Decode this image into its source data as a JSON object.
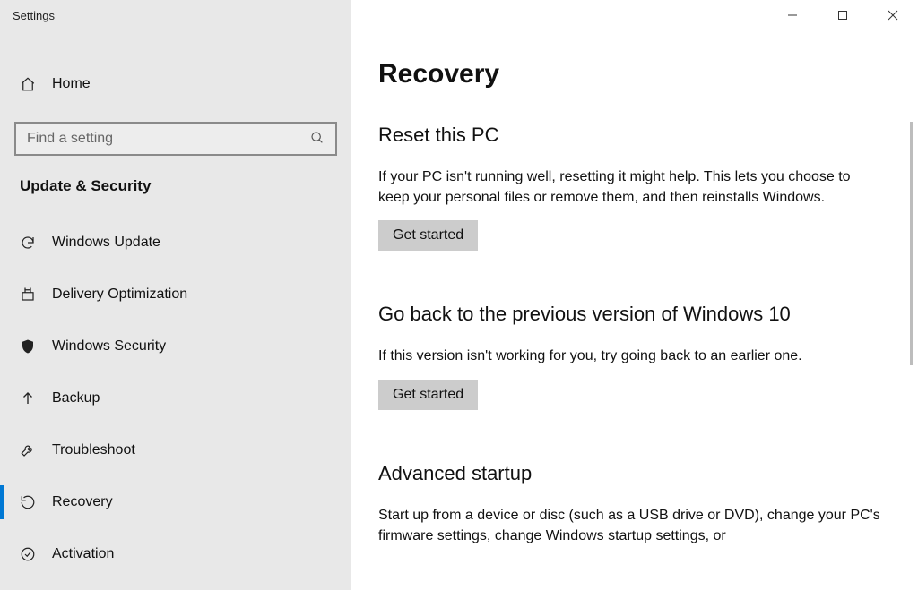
{
  "window": {
    "title": "Settings"
  },
  "sidebar": {
    "home_label": "Home",
    "search_placeholder": "Find a setting",
    "category": "Update & Security",
    "items": [
      {
        "label": "Windows Update"
      },
      {
        "label": "Delivery Optimization"
      },
      {
        "label": "Windows Security"
      },
      {
        "label": "Backup"
      },
      {
        "label": "Troubleshoot"
      },
      {
        "label": "Recovery"
      },
      {
        "label": "Activation"
      }
    ]
  },
  "page": {
    "title": "Recovery",
    "sections": [
      {
        "title": "Reset this PC",
        "desc": "If your PC isn't running well, resetting it might help. This lets you choose to keep your personal files or remove them, and then reinstalls Windows.",
        "button": "Get started"
      },
      {
        "title": "Go back to the previous version of Windows 10",
        "desc": "If this version isn't working for you, try going back to an earlier one.",
        "button": "Get started"
      },
      {
        "title": "Advanced startup",
        "desc": "Start up from a device or disc (such as a USB drive or DVD), change your PC's firmware settings, change Windows startup settings, or"
      }
    ]
  }
}
